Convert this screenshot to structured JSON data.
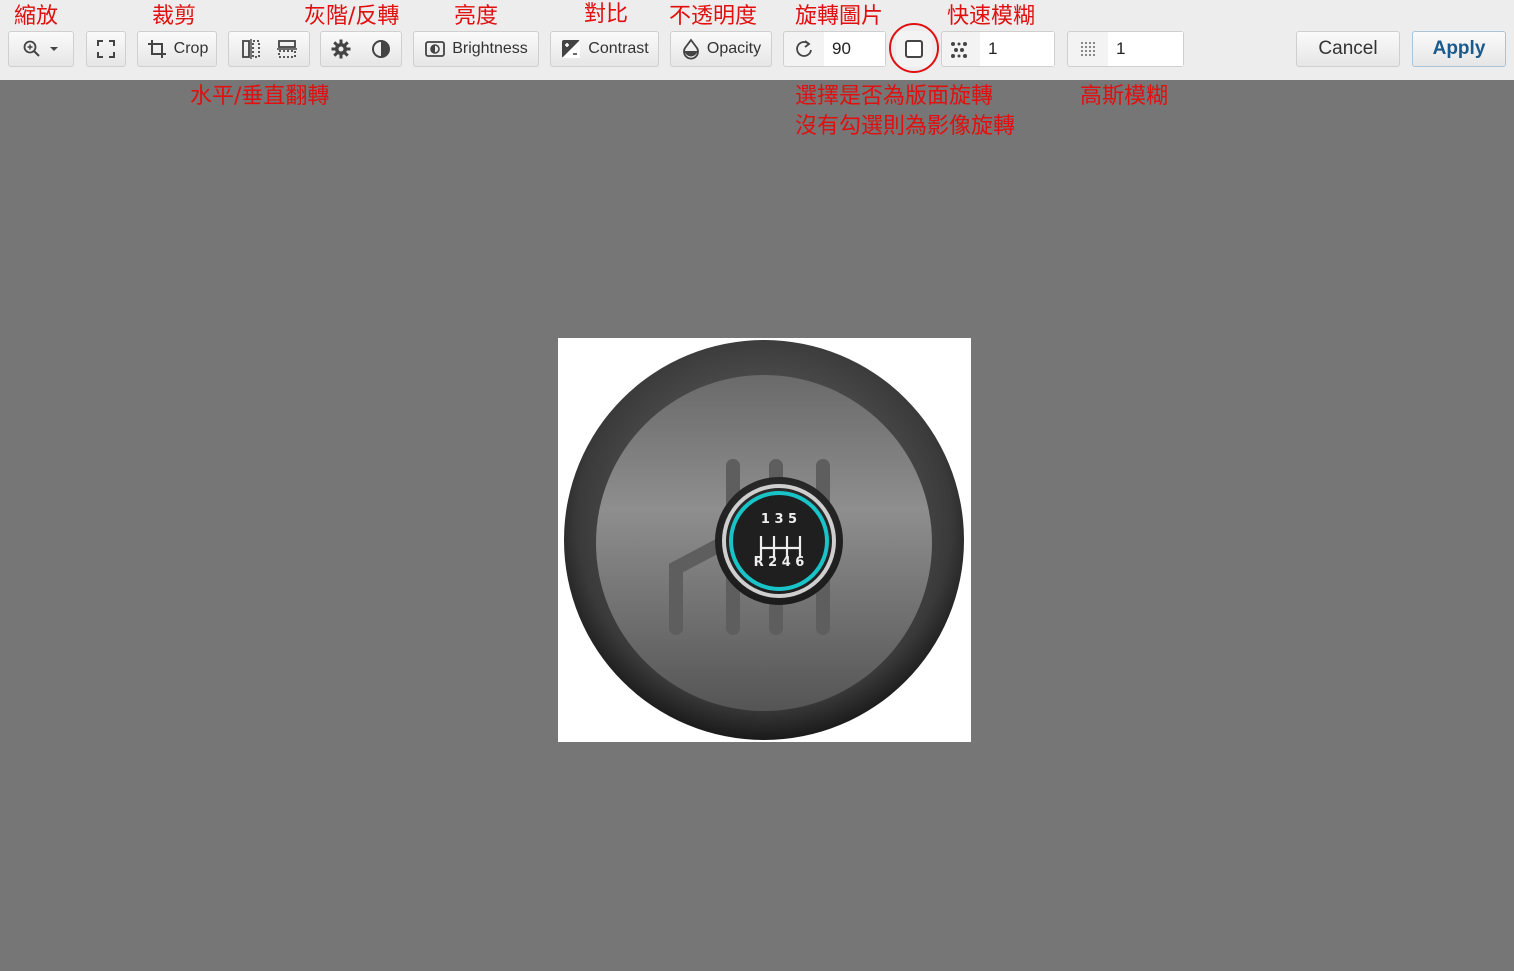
{
  "annotations": {
    "zoom": "縮放",
    "crop": "裁剪",
    "gray_invert": "灰階/反轉",
    "brightness": "亮度",
    "contrast": "對比",
    "opacity": "不透明度",
    "rotate": "旋轉圖片",
    "fast_blur": "快速模糊",
    "flip": "水平/垂直翻轉",
    "rotate_note_1": "選擇是否為版面旋轉",
    "rotate_note_2": "沒有勾選則為影像旋轉",
    "gaussian_blur": "高斯模糊"
  },
  "toolbar": {
    "crop_label": "Crop",
    "brightness_label": "Brightness",
    "contrast_label": "Contrast",
    "opacity_label": "Opacity",
    "rotate_value": "90",
    "fast_blur_value": "1",
    "gaussian_blur_value": "1",
    "cancel_label": "Cancel",
    "apply_label": "Apply"
  },
  "image": {
    "shifter_top": "1 3 5",
    "shifter_bottom": "R 2 4 6"
  },
  "colors": {
    "annotation": "#e01010",
    "apply_text": "#1a5a8c",
    "canvas_bg": "#767676",
    "accent_ring": "#18c4c8"
  }
}
